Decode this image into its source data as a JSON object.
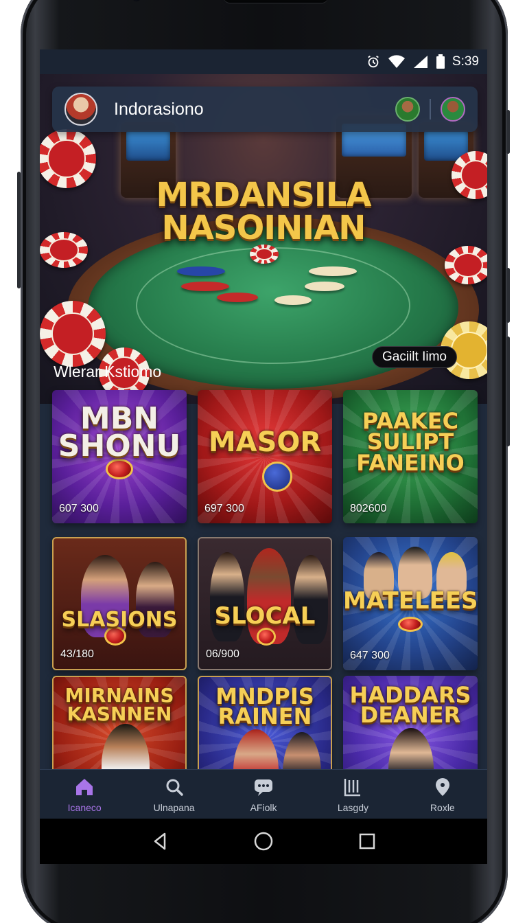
{
  "status_bar": {
    "time": "S:39",
    "icons": [
      "alarm-icon",
      "wifi-icon",
      "signal-icon",
      "battery-icon"
    ]
  },
  "app_bar": {
    "title": "Indorasiono",
    "avatars": [
      "user-avatar",
      "friend-avatar-1",
      "friend-avatar-2"
    ]
  },
  "hero": {
    "title_line1": "MRDANSILA",
    "title_line2": "NASOINIAN",
    "badge": "Gaciilt Iimo"
  },
  "section": {
    "title": "Wlerar Kstiomo"
  },
  "games": [
    {
      "name": "MBN\nSHONU",
      "value": "607 300"
    },
    {
      "name": "MASOR",
      "value": "697 300"
    },
    {
      "name": "PAAKEC\nSULIPT\nFANEINO",
      "value": "802600"
    },
    {
      "name": "SLASIONS",
      "value": "43/180"
    },
    {
      "name": "SLOCAL",
      "value": "06/900"
    },
    {
      "name": "MATELEES",
      "value": "647 300"
    },
    {
      "name": "MIRNAINS\nKASNNEN",
      "value": ""
    },
    {
      "name": "MNDPIS\nRAINEN",
      "value": ""
    },
    {
      "name": "HADDARS\nDEANER",
      "value": ""
    }
  ],
  "bottom_nav": [
    {
      "label": "Icaneco",
      "icon": "home-icon",
      "active": true
    },
    {
      "label": "Ulnapana",
      "icon": "search-icon",
      "active": false
    },
    {
      "label": "AFiolk",
      "icon": "chat-icon",
      "active": false
    },
    {
      "label": "Lasgdy",
      "icon": "library-icon",
      "active": false
    },
    {
      "label": "Roxle",
      "icon": "location-icon",
      "active": false
    }
  ],
  "system_nav": [
    "back-icon",
    "home-circle-icon",
    "recents-icon"
  ],
  "colors": {
    "screen_bg": "#1f2a3b",
    "accent": "#a875e8",
    "title_gold": "#f3c64a"
  }
}
